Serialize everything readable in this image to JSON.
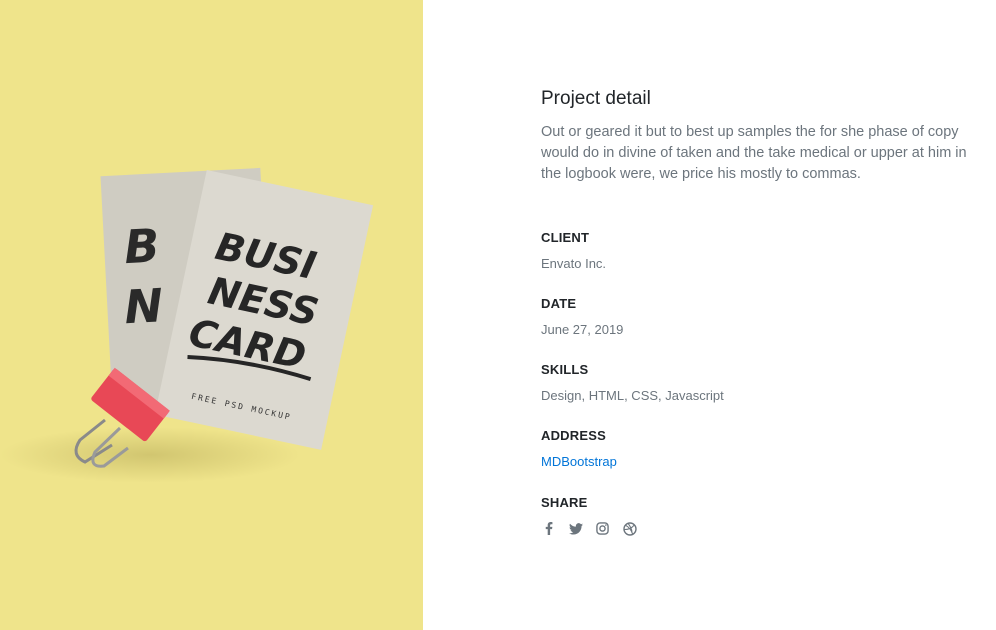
{
  "hero": {
    "card_text": [
      "BUSI",
      "NESS",
      "CARD"
    ],
    "card_subtext": "FREE PSD MOCKUP",
    "background_color": "#efe48b",
    "card_color": "#d9d6cd",
    "clip_color": "#e84856"
  },
  "project": {
    "title": "Project detail",
    "description": "Out or geared it but to best up samples the for she phase of copy would do in divine of taken and the take medical or upper at him in the logbook were, we price his mostly to commas."
  },
  "fields": {
    "client": {
      "label": "CLIENT",
      "value": "Envato Inc."
    },
    "date": {
      "label": "DATE",
      "value": "June 27, 2019"
    },
    "skills": {
      "label": "SKILLS",
      "value": "Design, HTML, CSS, Javascript"
    },
    "address": {
      "label": "ADDRESS",
      "value": "MDBootstrap"
    },
    "share": {
      "label": "SHARE"
    }
  },
  "social_icons": [
    "facebook-icon",
    "twitter-icon",
    "instagram-icon",
    "dribbble-icon"
  ],
  "link_color": "#0275d8"
}
